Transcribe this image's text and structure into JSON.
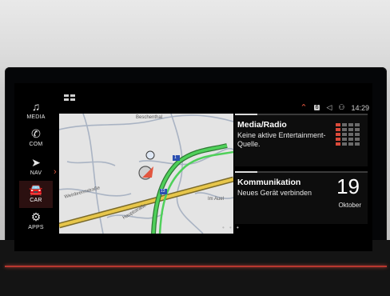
{
  "sidebar": {
    "items": [
      {
        "label": "MEDIA",
        "icon": "music-note-icon",
        "glyph": "♫",
        "active": false
      },
      {
        "label": "COM",
        "icon": "phone-icon",
        "glyph": "✆",
        "active": false
      },
      {
        "label": "NAV",
        "icon": "navigation-icon",
        "glyph": "➤",
        "active": false
      },
      {
        "label": "CAR",
        "icon": "car-icon",
        "glyph": "🚘",
        "active": true
      },
      {
        "label": "APPS",
        "icon": "apps-icon",
        "glyph": "⚙",
        "active": false
      }
    ]
  },
  "status_bar": {
    "notification_count": "6",
    "time": "14:29"
  },
  "map": {
    "labels": {
      "road_top": "Beschenthal",
      "road_left": "Weinbrennstraße",
      "road_bottom": "Hauptstraße",
      "road_right": "Im Auel",
      "exit_a": "1",
      "exit_b": "13"
    }
  },
  "media": {
    "title": "Media/Radio",
    "text": "Keine aktive Entertainment-Quelle."
  },
  "communication": {
    "title": "Kommunikation",
    "text": "Neues Gerät verbinden",
    "day": "19",
    "month": "Oktober"
  },
  "pager": "• • •",
  "colors": {
    "accent": "#e2563f",
    "route": "#4fd05a",
    "highway": "#e7c64a"
  }
}
